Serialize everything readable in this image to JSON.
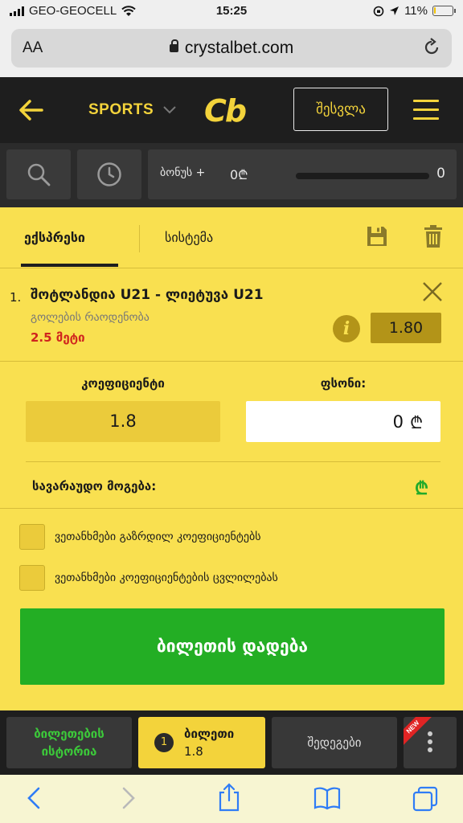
{
  "status": {
    "carrier": "GEO-GEOCELL",
    "time": "15:25",
    "battery": "11%",
    "battery_level": 0.11
  },
  "browser": {
    "aa_label": "AA",
    "domain": "crystalbet.com"
  },
  "header": {
    "sports_label": "SPORTS",
    "logo_text": "Cb",
    "login_label": "შესვლა"
  },
  "tools": {
    "bonus_label": "ბონუს +",
    "bonus_amount": "0₾",
    "bonus_count": "0"
  },
  "betslip": {
    "tabs": [
      {
        "label": "ექსპრესი",
        "active": true
      },
      {
        "label": "სისტემა",
        "active": false
      }
    ],
    "item": {
      "number": "1.",
      "title": "შოტლანდია U21 - ლიეტუვა U21",
      "market": "გოლების რაოდენობა",
      "pick": "2.5 მეტი",
      "odds": "1.80"
    },
    "odds_label": "კოეფიციენტი",
    "odds_value": "1.8",
    "stake_label": "ფსონი:",
    "stake_value": "0",
    "currency": "₾",
    "potential_win_label": "სავარაუდო მოგება:",
    "checkbox_increased": "ვეთანხმები გაზრდილ კოეფიციენტებს",
    "checkbox_changes": "ვეთანხმები კოეფიციენტების ცვლილებას",
    "place_bet_label": "ბილეთის დადება"
  },
  "bottom_nav": {
    "history_line1": "ბილეთების",
    "history_line2": "ისტორია",
    "ticket_count": "1",
    "ticket_label": "ბილეთი",
    "ticket_odds": "1.8",
    "results_label": "შედეგები",
    "new_badge": "NEW"
  },
  "colors": {
    "brand_yellow": "#f9e050",
    "header_dark": "#1e1e1e",
    "accent_gold": "#b39418",
    "action_green": "#23ae24",
    "pick_red": "#d0241e"
  }
}
